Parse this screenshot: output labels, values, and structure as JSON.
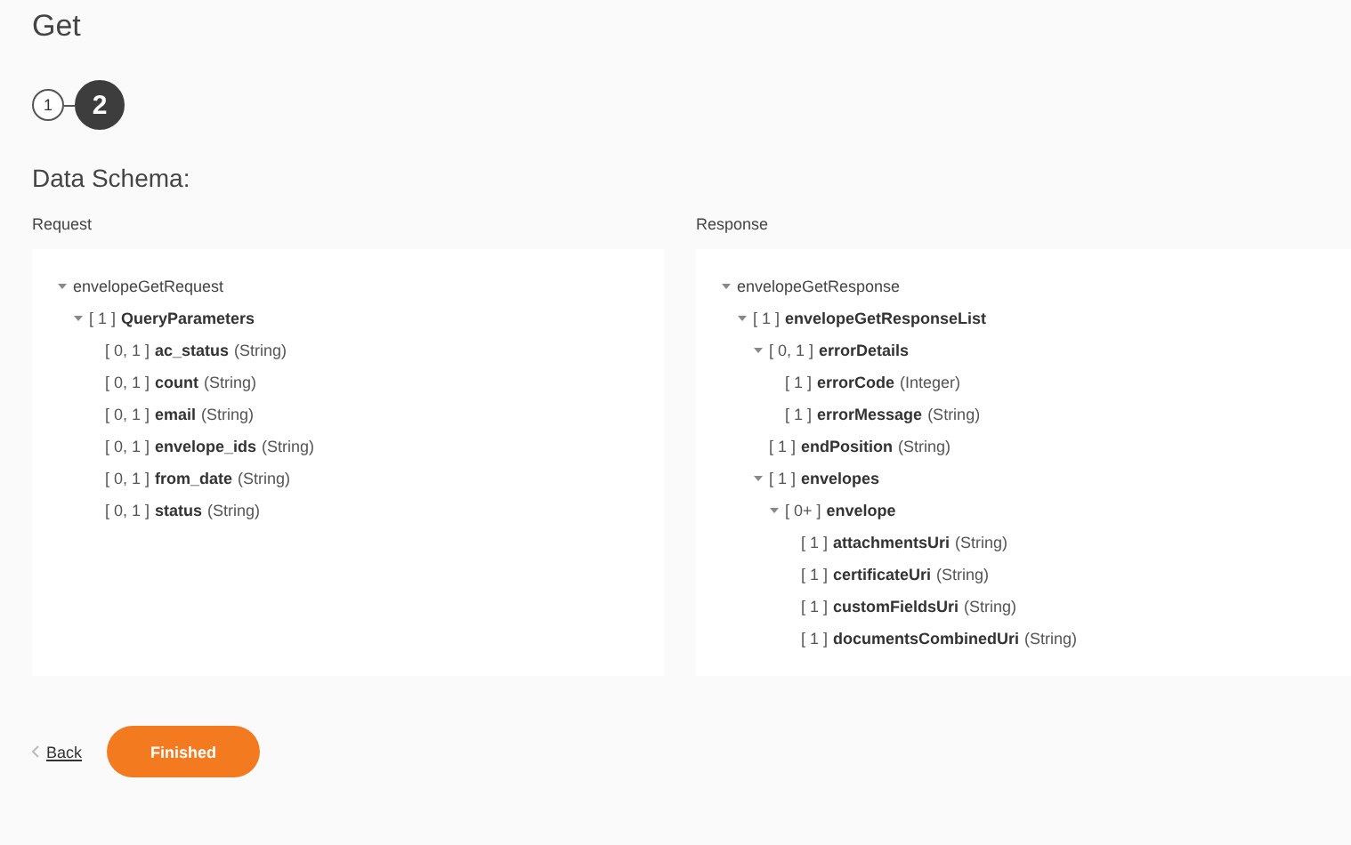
{
  "title": "Get",
  "steps": [
    {
      "number": "1",
      "selected": false
    },
    {
      "number": "2",
      "selected": true
    }
  ],
  "section_title": "Data Schema:",
  "panels": [
    {
      "label": "Request",
      "tree": [
        {
          "name": "envelopeGetRequest",
          "expanded": true,
          "children": [
            {
              "cardinality": "[ 1 ]",
              "name": "QueryParameters",
              "expanded": true,
              "children": [
                {
                  "cardinality": "[ 0, 1 ]",
                  "name": "ac_status",
                  "type": "(String)"
                },
                {
                  "cardinality": "[ 0, 1 ]",
                  "name": "count",
                  "type": "(String)"
                },
                {
                  "cardinality": "[ 0, 1 ]",
                  "name": "email",
                  "type": "(String)"
                },
                {
                  "cardinality": "[ 0, 1 ]",
                  "name": "envelope_ids",
                  "type": "(String)"
                },
                {
                  "cardinality": "[ 0, 1 ]",
                  "name": "from_date",
                  "type": "(String)"
                },
                {
                  "cardinality": "[ 0, 1 ]",
                  "name": "status",
                  "type": "(String)"
                }
              ]
            }
          ]
        }
      ]
    },
    {
      "label": "Response",
      "tree": [
        {
          "name": "envelopeGetResponse",
          "expanded": true,
          "children": [
            {
              "cardinality": "[ 1 ]",
              "name": "envelopeGetResponseList",
              "expanded": true,
              "children": [
                {
                  "cardinality": "[ 0, 1 ]",
                  "name": "errorDetails",
                  "expanded": true,
                  "children": [
                    {
                      "cardinality": "[ 1 ]",
                      "name": "errorCode",
                      "type": "(Integer)"
                    },
                    {
                      "cardinality": "[ 1 ]",
                      "name": "errorMessage",
                      "type": "(String)"
                    }
                  ]
                },
                {
                  "cardinality": "[ 1 ]",
                  "name": "endPosition",
                  "type": "(String)"
                },
                {
                  "cardinality": "[ 1 ]",
                  "name": "envelopes",
                  "expanded": true,
                  "children": [
                    {
                      "cardinality": "[ 0+ ]",
                      "name": "envelope",
                      "expanded": true,
                      "children": [
                        {
                          "cardinality": "[ 1 ]",
                          "name": "attachmentsUri",
                          "type": "(String)"
                        },
                        {
                          "cardinality": "[ 1 ]",
                          "name": "certificateUri",
                          "type": "(String)"
                        },
                        {
                          "cardinality": "[ 1 ]",
                          "name": "customFieldsUri",
                          "type": "(String)"
                        },
                        {
                          "cardinality": "[ 1 ]",
                          "name": "documentsCombinedUri",
                          "type": "(String)"
                        }
                      ]
                    }
                  ]
                }
              ]
            }
          ]
        }
      ]
    }
  ],
  "back_link": "Back",
  "finish_button": "Finished"
}
